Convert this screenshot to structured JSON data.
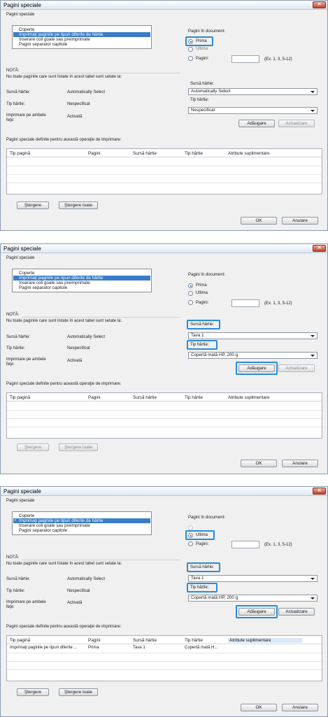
{
  "dialog": {
    "title": "Pagini speciale",
    "close_glyph": "✕",
    "group_label": "Pagini speciale",
    "page_types": [
      "Coperte",
      "Imprimaţi paginile pe tipuri diferite de hârtie",
      "Inserare coli goale sau preimprimate",
      "Pagini separator capitole"
    ],
    "pages_in_doc_label": "Pagini în document:",
    "radio_first": "Prima",
    "radio_last": "Ultima",
    "radio_pages": "Pagini:",
    "pages_example": "(Ex. 1, 3, 5-12)",
    "note_title": "NOTĂ:",
    "note_text": "Nu toate paginile care sunt listate în acest tabel sunt setate la:",
    "paper_source_label": "Sursă hârtie:",
    "paper_source_value": "Automatically Select",
    "paper_type_label": "Tip hârtie:",
    "paper_type_value": "Nespecificat",
    "duplex_label_1": "Imprimare pe ambele",
    "duplex_label_2": "feţe:",
    "duplex_value": "Activată",
    "right_source_label": "Sursă hârtie:",
    "right_type_label": "Tip hârtie:",
    "add_button": "Adăugare",
    "update_button": "Actualizare",
    "table_title": "Pagini speciale definite pentru această operaţie de imprimare:",
    "columns": [
      "Tip pagină",
      "Pagini",
      "Sursă hârtie",
      "Tip hârtie",
      "Atribute suplimentare"
    ],
    "delete_button": "Ştergere",
    "delete_all_button": "Ştergere toate",
    "ok_button": "OK",
    "cancel_button": "Anulare"
  },
  "states": [
    {
      "source_select": "Automatically Select",
      "type_select": "Nespecificat",
      "pages_radio": "first"
    },
    {
      "source_select": "Tava 1",
      "type_select": "Copertă mată HP, 200 g",
      "pages_radio": "first"
    },
    {
      "source_select": "Tava 1",
      "type_select": "Copertă mată HP, 200 g",
      "pages_radio": "last",
      "row": [
        "Imprimaţi paginile pe tipuri diferite ...",
        "Prima",
        "Tava 1",
        "Copertă mată H..."
      ]
    }
  ],
  "colors": {
    "selection": "#3a7cc8",
    "highlight": "#2b8bd6"
  }
}
